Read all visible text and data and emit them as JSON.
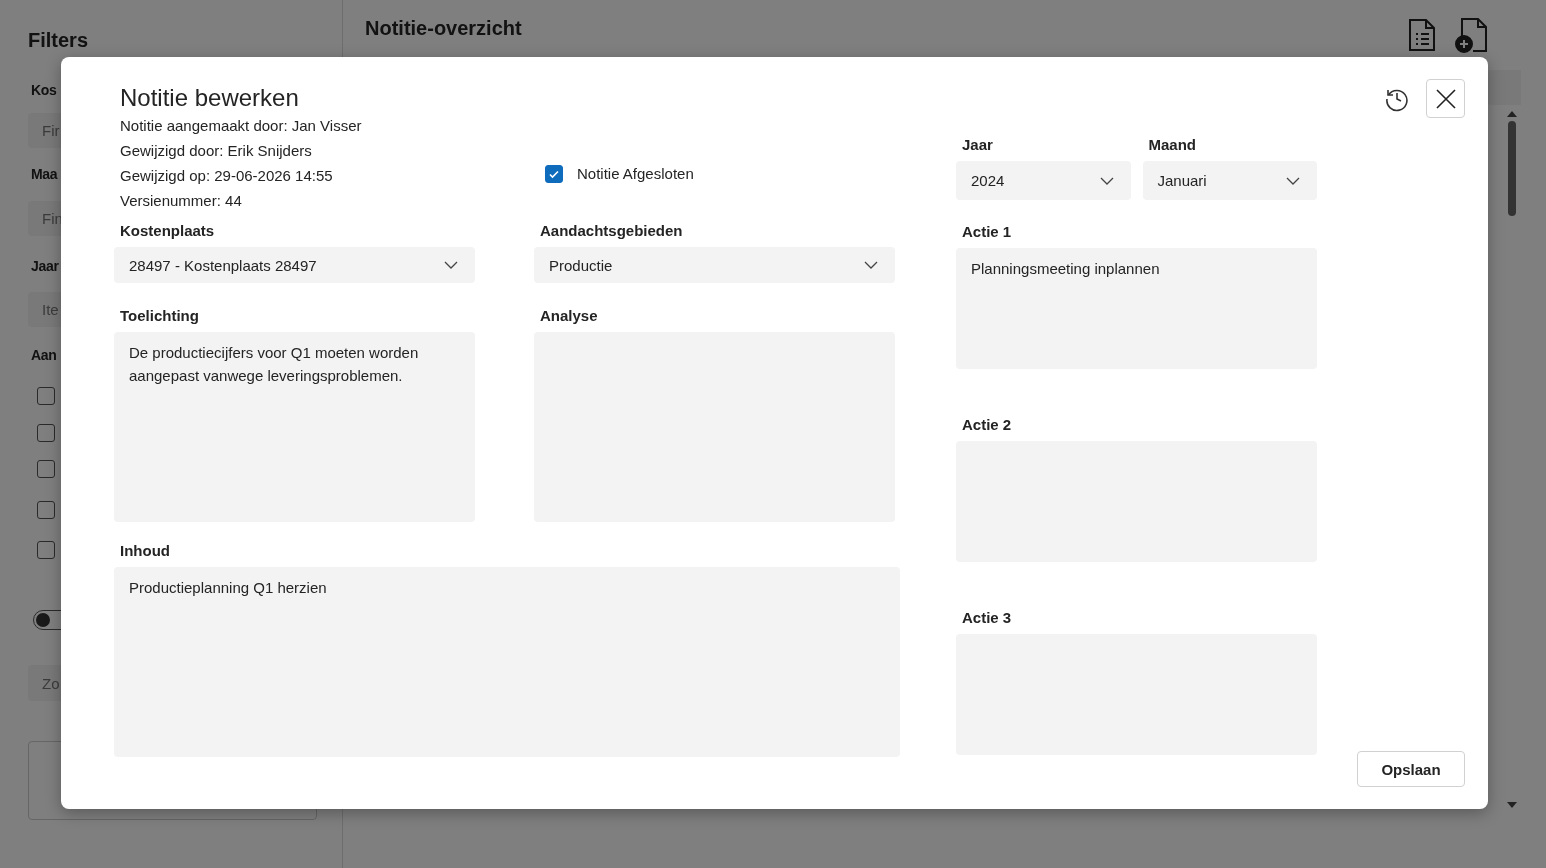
{
  "background": {
    "sidebar": {
      "title": "Filters",
      "fields": [
        {
          "label": "Kos",
          "placeholder": "Fir"
        },
        {
          "label": "Maa",
          "placeholder": "Fin"
        },
        {
          "label": "Jaar",
          "placeholder": "Ite"
        }
      ],
      "section_label": "Aan",
      "checkboxes": [
        {
          "checked": false
        },
        {
          "checked": false
        },
        {
          "checked": false
        },
        {
          "checked": false
        },
        {
          "checked": false
        }
      ],
      "toggle": {
        "on": false
      },
      "search": {
        "placeholder": "Zo"
      }
    },
    "main": {
      "title": "Notitie-overzicht"
    }
  },
  "dialog": {
    "title": "Notitie bewerken",
    "meta": [
      "Notitie aangemaakt door: Jan Visser",
      "Gewijzigd door: Erik Snijders",
      "Gewijzigd op: 29-06-2026 14:55",
      "Versienummer: 44"
    ],
    "closed_checkbox": {
      "label": "Notitie Afgesloten",
      "checked": true
    },
    "cost_center": {
      "label": "Kostenplaats",
      "value": "28497 - Kostenplaats 28497"
    },
    "focus_areas": {
      "label": "Aandachtsgebieden",
      "value": "Productie"
    },
    "explanation": {
      "label": "Toelichting",
      "value": "De productiecijfers voor Q1 moeten worden aangepast vanwege leveringsproblemen."
    },
    "analysis": {
      "label": "Analyse"
    },
    "content": {
      "label": "Inhoud",
      "value": "Productieplanning Q1 herzien"
    },
    "year": {
      "label": "Jaar",
      "value": "2024"
    },
    "month": {
      "label": "Maand",
      "value": "Januari"
    },
    "actions": [
      {
        "label": "Actie 1",
        "value": "Planningsmeeting inplannen"
      },
      {
        "label": "Actie 2"
      },
      {
        "label": "Actie 3"
      }
    ],
    "save_button": "Opslaan"
  }
}
